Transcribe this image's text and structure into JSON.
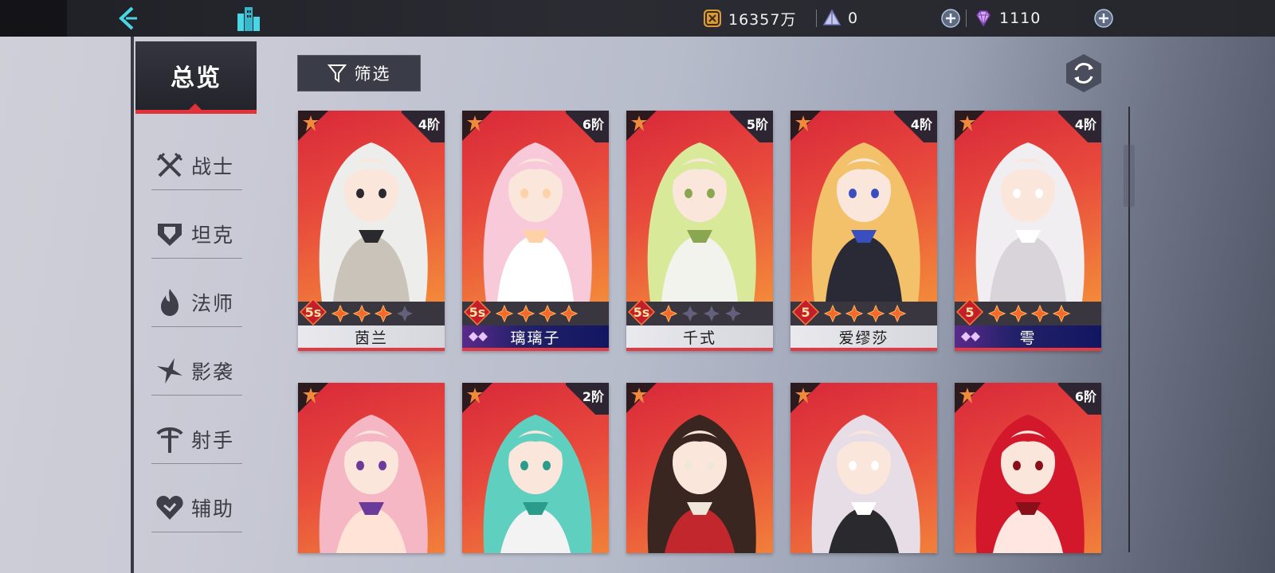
{
  "topbar": {
    "gold": "16357万",
    "tickets": "0",
    "gems": "1110"
  },
  "sidebar": {
    "overview": "总览",
    "classes": [
      {
        "label": "战士",
        "icon": "crossed-swords-icon"
      },
      {
        "label": "坦克",
        "icon": "shield-icon"
      },
      {
        "label": "法师",
        "icon": "flame-icon"
      },
      {
        "label": "影袭",
        "icon": "shuriken-icon"
      },
      {
        "label": "射手",
        "icon": "bow-icon"
      },
      {
        "label": "辅助",
        "icon": "heart-icon"
      }
    ]
  },
  "filter": {
    "label": "筛选"
  },
  "cards": [
    {
      "name": "茵兰",
      "tier": "4阶",
      "rank": "5s",
      "stars": 3,
      "special": false,
      "palette": [
        "#ededeb",
        "#c9c3b9",
        "#2a2a2e"
      ]
    },
    {
      "name": "璃璃子",
      "tier": "6阶",
      "rank": "5s",
      "stars": 4,
      "special": true,
      "palette": [
        "#f7c9d9",
        "#ffffff",
        "#ffd1a6"
      ]
    },
    {
      "name": "千式",
      "tier": "5阶",
      "rank": "5s",
      "stars": 1,
      "special": false,
      "palette": [
        "#d8ea9a",
        "#f3f3ee",
        "#8aa650"
      ]
    },
    {
      "name": "爱缪莎",
      "tier": "4阶",
      "rank": "5",
      "stars": 4,
      "special": false,
      "palette": [
        "#f2c16a",
        "#2a2a36",
        "#3a4fbf"
      ]
    },
    {
      "name": "雩",
      "tier": "4阶",
      "rank": "5",
      "stars": 4,
      "special": true,
      "palette": [
        "#f1eef1",
        "#d9d3da",
        "#ffffff"
      ]
    },
    {
      "name": "",
      "tier": "",
      "rank": "",
      "stars": 0,
      "special": false,
      "palette": [
        "#f5b7c4",
        "#ffe3d6",
        "#6a3b9a"
      ]
    },
    {
      "name": "",
      "tier": "2阶",
      "rank": "",
      "stars": 0,
      "special": false,
      "palette": [
        "#5fd0c0",
        "#f3f3f3",
        "#2a9c8c"
      ]
    },
    {
      "name": "",
      "tier": "",
      "rank": "",
      "stars": 0,
      "special": false,
      "palette": [
        "#3a2620",
        "#c1272d",
        "#f0e6da"
      ]
    },
    {
      "name": "",
      "tier": "",
      "rank": "",
      "stars": 0,
      "special": false,
      "palette": [
        "#e6dde6",
        "#2a2a2e",
        "#ffffff"
      ]
    },
    {
      "name": "",
      "tier": "6阶",
      "rank": "",
      "stars": 0,
      "special": false,
      "palette": [
        "#d3182b",
        "#ffe6e0",
        "#8a0f1b"
      ]
    }
  ]
}
